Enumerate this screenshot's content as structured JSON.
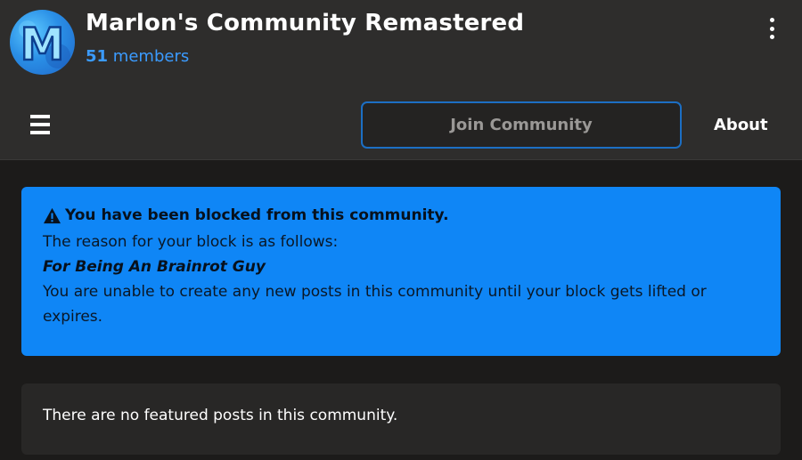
{
  "community": {
    "name": "Marlon's Community Remastered",
    "member_count": "51",
    "member_label": "members",
    "avatar_letter": "M",
    "avatar_color": "#2a8fe6"
  },
  "nav": {
    "menu_icon": "hamburger-icon",
    "join_label": "Join Community",
    "about_label": "About",
    "more_icon": "kebab-menu-icon"
  },
  "alert": {
    "icon": "warning-triangle-icon",
    "headline": "You have been blocked from this community.",
    "reason_intro": "The reason for your block is as follows:",
    "reason": "For Being An Brainrot Guy",
    "details": "You are unable to create any new posts in this community until your block gets lifted or expires.",
    "color": "#0f86f6"
  },
  "featured": {
    "empty_text": "There are no featured posts in this community."
  },
  "colors": {
    "accent": "#3b9bff",
    "header_bg": "#2e2d2c",
    "page_bg": "#1c1b1a"
  }
}
